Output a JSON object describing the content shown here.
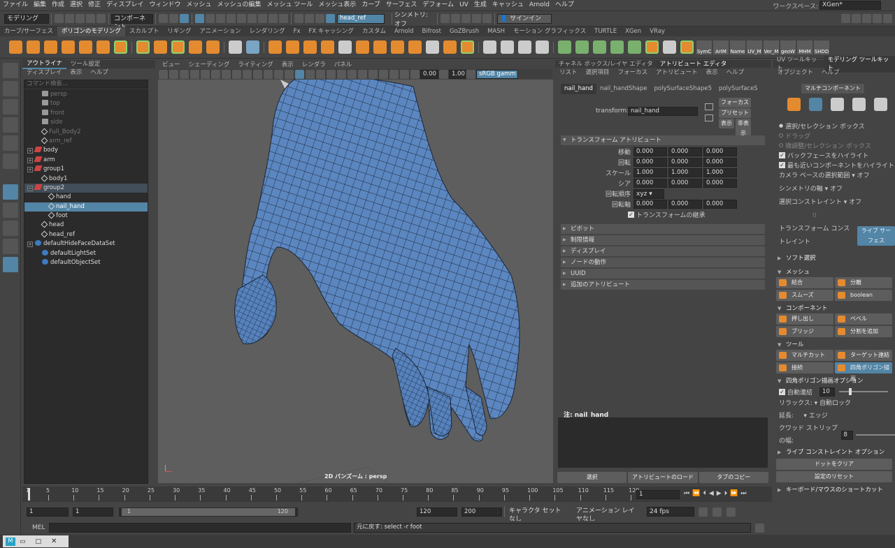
{
  "menubar": {
    "items": [
      "ファイル",
      "編集",
      "作成",
      "選択",
      "修正",
      "ディスプレイ",
      "ウィンドウ",
      "メッシュ",
      "メッシュの編集",
      "メッシュ ツール",
      "メッシュ表示",
      "カーブ",
      "サーフェス",
      "デフォーム",
      "UV",
      "生成",
      "キャッシュ",
      "Arnold",
      "ヘルプ"
    ],
    "workspace_label": "ワークスペース:",
    "workspace_value": "XGen*"
  },
  "statusline": {
    "mode": "モデリング",
    "component": "コンポーネント",
    "input_field": "head_ref",
    "symmetry": "シンメトリ: オフ",
    "signin": "サインイン"
  },
  "shelf_tabs": [
    "カーブ/サーフェス",
    "ポリゴンのモデリング",
    "スカルプト",
    "リギング",
    "アニメーション",
    "レンダリング",
    "Fx",
    "FX キャッシング",
    "カスタム",
    "Arnold",
    "Bifrost",
    "GoZBrush",
    "MASH",
    "モーション グラフィックス",
    "TURTLE",
    "XGen",
    "VRay"
  ],
  "shelf_labels": [
    "SymC",
    "ArIM",
    "Name",
    "UV_M",
    "Ver_M",
    "geoW",
    "MHM",
    "SHDD"
  ],
  "outliner": {
    "tabs": [
      "アウトライナ",
      "ツール設定"
    ],
    "menu": [
      "ディスプレイ",
      "表示",
      "ヘルプ"
    ],
    "search_placeholder": "コマンド検索...",
    "items": [
      {
        "label": "persp",
        "icon": "cam",
        "indent": 1,
        "state": "dim"
      },
      {
        "label": "top",
        "icon": "cam",
        "indent": 1,
        "state": "dim"
      },
      {
        "label": "front",
        "icon": "cam",
        "indent": 1,
        "state": "dim"
      },
      {
        "label": "side",
        "icon": "cam",
        "indent": 1,
        "state": "dim"
      },
      {
        "label": "Full_Body2",
        "icon": "mesh",
        "indent": 1,
        "state": "dim"
      },
      {
        "label": "arm_ref",
        "icon": "mesh",
        "indent": 1,
        "state": "dim"
      },
      {
        "label": "body",
        "icon": "grp",
        "indent": 0,
        "exp": "+"
      },
      {
        "label": "arm",
        "icon": "grp",
        "indent": 0,
        "exp": "+"
      },
      {
        "label": "group1",
        "icon": "grp",
        "indent": 0,
        "exp": "+"
      },
      {
        "label": "body1",
        "icon": "mesh",
        "indent": 1
      },
      {
        "label": "group2",
        "icon": "grp",
        "indent": 0,
        "exp": "−",
        "state": "hl"
      },
      {
        "label": "hand",
        "icon": "mesh",
        "indent": 2
      },
      {
        "label": "nail_hand",
        "icon": "mesh",
        "indent": 2,
        "state": "sel"
      },
      {
        "label": "foot",
        "icon": "mesh",
        "indent": 2
      },
      {
        "label": "head",
        "icon": "mesh",
        "indent": 1
      },
      {
        "label": "head_ref",
        "icon": "mesh",
        "indent": 1
      },
      {
        "label": "defaultHideFaceDataSet",
        "icon": "set",
        "indent": 0,
        "exp": "+"
      },
      {
        "label": "defaultLightSet",
        "icon": "set",
        "indent": 1
      },
      {
        "label": "defaultObjectSet",
        "icon": "set",
        "indent": 1
      }
    ]
  },
  "viewport": {
    "menu": [
      "ビュー",
      "シェーディング",
      "ライティング",
      "表示",
      "レンダラ",
      "パネル"
    ],
    "val1": "0.00",
    "val2": "1.00",
    "colorspace": "sRGB gamm",
    "camera_label": "2D パンズーム : persp"
  },
  "attr": {
    "top_tabs": [
      "チャネル ボックス/レイヤ エディタ",
      "アトリビュート エディタ"
    ],
    "menu": [
      "リスト",
      "選択項目",
      "フォーカス",
      "アトリビュート",
      "表示",
      "ヘルプ"
    ],
    "node_tabs": [
      "nail_hand",
      "nail_handShape",
      "polySurfaceShape5",
      "polySurfaceS"
    ],
    "transform_label": "transform:",
    "transform_value": "nail_hand",
    "btn_focus": "フォーカス",
    "btn_preset": "プリセット",
    "btn_show": "表示",
    "btn_hide": "非表示",
    "section_transform": "トランスフォーム アトリビュート",
    "rows": [
      {
        "label": "移動",
        "v": [
          "0.000",
          "0.000",
          "0.000"
        ]
      },
      {
        "label": "回転",
        "v": [
          "0.000",
          "0.000",
          "0.000"
        ]
      },
      {
        "label": "スケール",
        "v": [
          "1.000",
          "1.000",
          "1.000"
        ]
      },
      {
        "label": "シア",
        "v": [
          "0.000",
          "0.000",
          "0.000"
        ]
      }
    ],
    "rot_order_label": "回転順序",
    "rot_order": "xyz",
    "rot_axis_label": "回転軸",
    "rot_axis": [
      "0.000",
      "0.000",
      "0.000"
    ],
    "inherit": "トランスフォームの継承",
    "sections": [
      "ピボット",
      "制限情報",
      "ディスプレイ",
      "ノードの動作",
      "UUID",
      "追加のアトリビュート"
    ],
    "notes_label": "注: nail_hand",
    "bottom_buttons": [
      "選択",
      "アトリビュートのロード",
      "タブのコピー"
    ]
  },
  "mtk": {
    "tabs": [
      "UV ツールキット",
      "モデリング ツールキット"
    ],
    "menu": [
      "オブジェクト",
      "ヘルプ"
    ],
    "multi": "マルチコンポーネント",
    "radios": [
      "選択/セレクション ボックス",
      "ドラッグ",
      "微調整/セレクション ボックス"
    ],
    "checks": [
      "バックフェースをハイライト",
      "最も近いコンポーネントをハイライト"
    ],
    "cam_sel": "カメラ ベースの選択範囲",
    "cam_sel_val": "オフ",
    "sym_axis": "シンメトリの軸",
    "sym_axis_val": "オフ",
    "sel_const": "選択コンストレイント",
    "sel_const_val": "オフ",
    "sel_const_num": "0",
    "tr_const": "トランスフォーム コンストレイント",
    "tr_const_val": "ライブ サーフェス",
    "soft": "ソフト選択",
    "mesh_head": "メッシュ",
    "mesh_btns": [
      "結合",
      "分離",
      "スムーズ",
      "boolean"
    ],
    "comp_head": "コンポーネント",
    "comp_btns": [
      "押し出し",
      "ベベル",
      "ブリッジ",
      "分割を追加"
    ],
    "tool_head": "ツール",
    "tool_btns": [
      "マルチカット",
      "ターゲット連結",
      "接続",
      "四角ポリゴン描画"
    ],
    "quad_head": "四角ポリゴン描画オプション",
    "auto_weld": "自動連結",
    "auto_weld_val": "10",
    "relax": "リラックス:",
    "relax_val": "自動ロック",
    "extend": "延長:",
    "extend_val": "エッジ",
    "strip": "クワッド ストリップの幅:",
    "strip_val": "8",
    "live_head": "ライブ コンストレイント オプション",
    "btn_clear": "ドットをクリア",
    "btn_reset": "設定のリセット",
    "shortcuts": "キーボード/マウスのショートカット"
  },
  "time": {
    "ticks": [
      "1",
      "5",
      "10",
      "15",
      "20",
      "25",
      "30",
      "35",
      "40",
      "45",
      "50",
      "55",
      "60",
      "65",
      "70",
      "75",
      "80",
      "85",
      "90",
      "95",
      "100",
      "105",
      "110",
      "115",
      "120"
    ],
    "current": "1"
  },
  "range": {
    "start": "1",
    "inner_start": "1",
    "slider_start": "1",
    "slider_end": "120",
    "inner_end": "120",
    "end": "200",
    "char_set": "キャラクタ セットなし",
    "anim_layer": "アニメーション レイヤなし",
    "fps": "24 fps"
  },
  "cmd": {
    "lang": "MEL",
    "feedback": "元に戻す: select -r foot"
  },
  "colors": {
    "accent": "#5285a6",
    "mesh_blue": "#5b86c0",
    "orange": "#e48b30"
  }
}
